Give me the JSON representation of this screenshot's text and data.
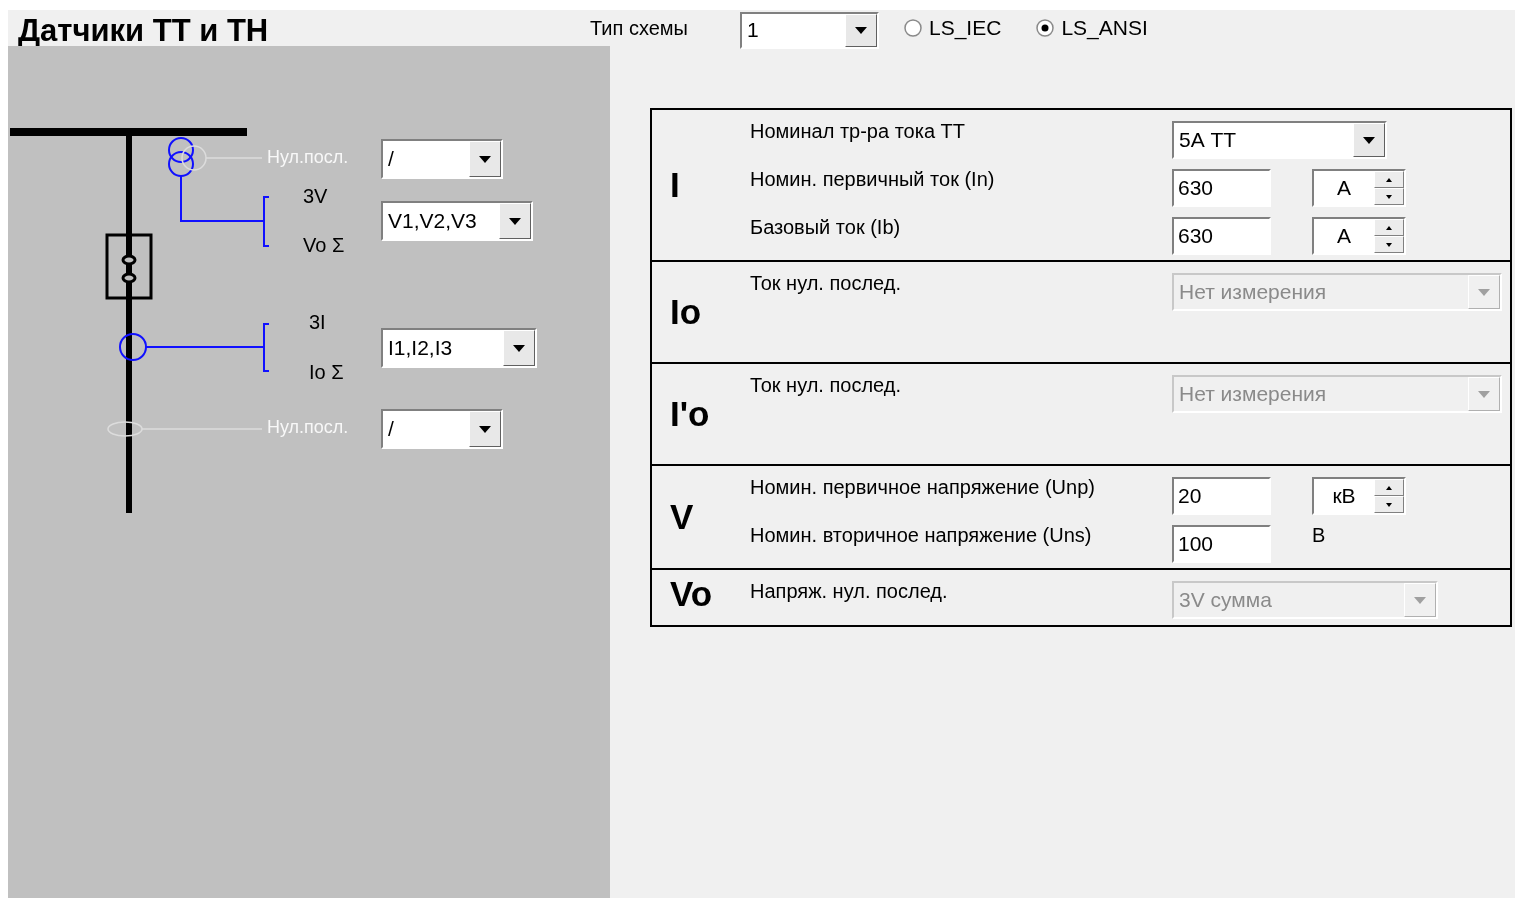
{
  "header": {
    "title": "Датчики ТТ и ТН",
    "scheme_label": "Тип схемы",
    "scheme_select": "1",
    "radios": [
      {
        "label": "LS_IEC",
        "selected": false
      },
      {
        "label": "LS_ANSI",
        "selected": true
      }
    ]
  },
  "diagram": {
    "vt_null": {
      "label": "Нул.посл.",
      "select": "/",
      "disabled": true
    },
    "vt": {
      "label_top": "3V",
      "label_bottom": "Vo Σ",
      "select": "V1,V2,V3"
    },
    "ct": {
      "label_top": "3I",
      "label_bottom": "Io Σ",
      "select": "I1,I2,I3"
    },
    "ct_null": {
      "label": "Нул.посл.",
      "select": "/",
      "disabled": true
    }
  },
  "sections": [
    {
      "symbol": "I",
      "rows": [
        {
          "kind": "select",
          "label": "Номинал тр-ра тока ТТ",
          "value": "5А ТТ",
          "disabled": false
        },
        {
          "kind": "spin",
          "label": "Номин. первичный ток (In)",
          "value": "630",
          "unit": "А"
        },
        {
          "kind": "spin",
          "label": "Базовый ток (Ib)",
          "value": "630",
          "unit": "А"
        }
      ]
    },
    {
      "symbol": "Io",
      "rows": [
        {
          "kind": "select",
          "label": "Ток нул. послед.",
          "value": "Нет измерения",
          "disabled": true
        }
      ]
    },
    {
      "symbol": "I'o",
      "rows": [
        {
          "kind": "select",
          "label": "Ток нул. послед.",
          "value": "Нет измерения",
          "disabled": true
        }
      ]
    },
    {
      "symbol": "V",
      "rows": [
        {
          "kind": "spin",
          "label": "Номин. первичное напряжение (Unp)",
          "value": "20",
          "unit": "кВ"
        },
        {
          "kind": "number",
          "label": "Номин. вторичное напряжение (Uns)",
          "value": "100",
          "unit": "В"
        }
      ]
    },
    {
      "symbol": "Vo",
      "rows": [
        {
          "kind": "select",
          "label": "Напряж. нул. послед.",
          "value": "3V сумма",
          "disabled": true
        }
      ]
    }
  ]
}
